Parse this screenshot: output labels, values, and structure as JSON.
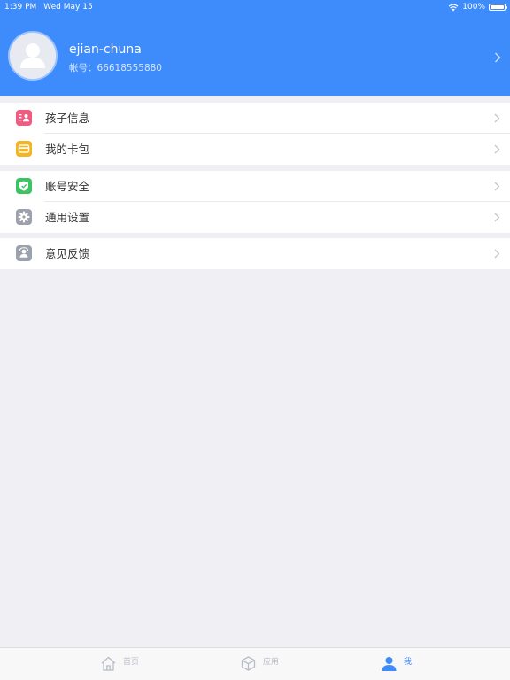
{
  "status_bar": {
    "time": "1:39 PM",
    "date": "Wed May 15",
    "battery_text": "100%",
    "battery_level": 1.0
  },
  "profile": {
    "username": "ejian-chuna",
    "account_label": "帐号：",
    "account_number": "66618555880"
  },
  "menu_groups": [
    {
      "items": [
        {
          "label": "孩子信息",
          "icon": "child-info-icon",
          "color": "#f15b7f"
        },
        {
          "label": "我的卡包",
          "icon": "card-wallet-icon",
          "color": "#f5b521"
        }
      ]
    },
    {
      "items": [
        {
          "label": "账号安全",
          "icon": "shield-check-icon",
          "color": "#3cc463"
        },
        {
          "label": "通用设置",
          "icon": "gear-icon",
          "color": "#9ba1ad"
        }
      ]
    },
    {
      "items": [
        {
          "label": "意见反馈",
          "icon": "feedback-icon",
          "color": "#9ba1ad"
        }
      ]
    }
  ],
  "tabs": [
    {
      "label": "首页",
      "icon": "home-icon",
      "active": false
    },
    {
      "label": "应用",
      "icon": "cube-icon",
      "active": false
    },
    {
      "label": "我",
      "icon": "person-icon",
      "active": true
    }
  ],
  "colors": {
    "brand": "#3e8bfc",
    "background": "#efeff4",
    "inactive_tab": "#b8bcc6"
  }
}
